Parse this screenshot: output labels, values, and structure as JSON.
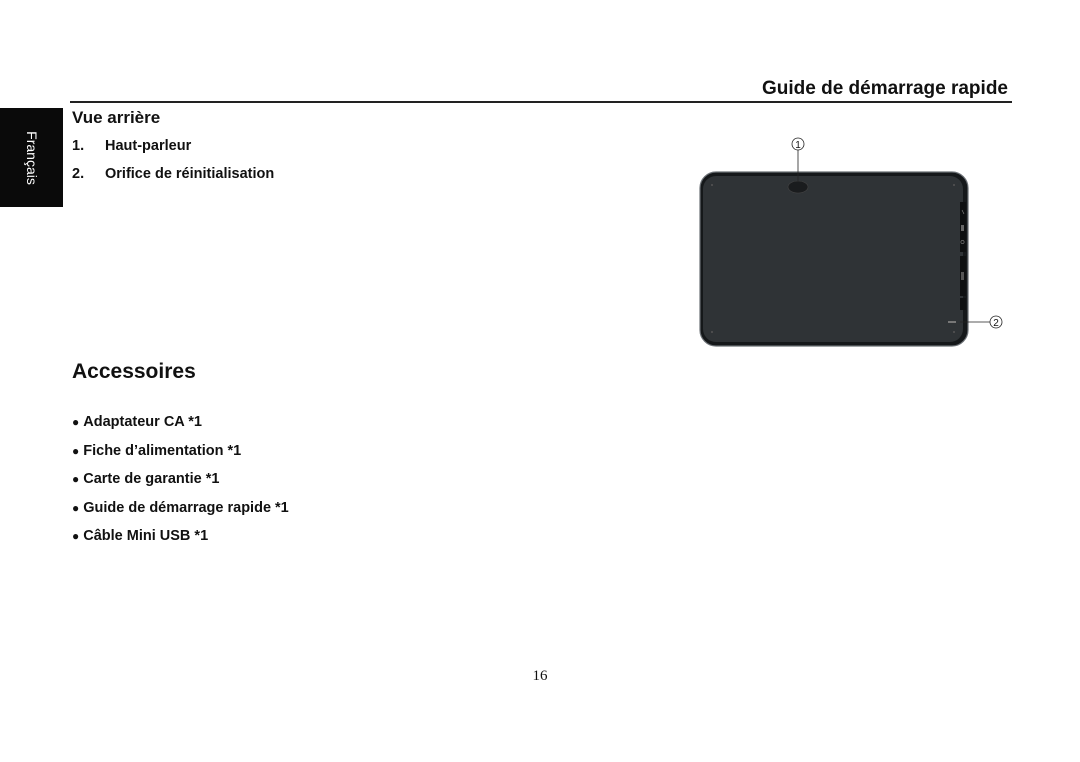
{
  "header": {
    "title": "Guide de démarrage rapide"
  },
  "language_tab": {
    "label": "Français"
  },
  "rear_view": {
    "title": "Vue arrière",
    "items": [
      {
        "number": "1.",
        "label": "Haut-parleur"
      },
      {
        "number": "2.",
        "label": "Orifice de réinitialisation"
      }
    ],
    "callouts": [
      "1",
      "2"
    ]
  },
  "accessories": {
    "title": "Accessoires",
    "bullet": "●",
    "items": [
      "Adaptateur CA *1",
      "Fiche d’alimentation *1",
      "Carte de garantie *1",
      "Guide de démarrage rapide *1",
      "Câble Mini USB *1"
    ]
  },
  "footer": {
    "page_number": "16"
  },
  "colors": {
    "tablet_body": "#2f3336",
    "tablet_edge": "#15181a",
    "tab_bg": "#0a0a0a"
  }
}
